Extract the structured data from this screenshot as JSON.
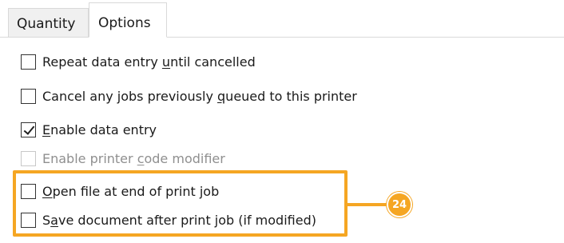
{
  "tabs": [
    {
      "label": "Quantity",
      "active": false
    },
    {
      "label": "Options",
      "active": true
    }
  ],
  "options": [
    {
      "pre": "Repeat data entry ",
      "u": "u",
      "post": "ntil cancelled",
      "checked": false,
      "enabled": true
    },
    {
      "pre": "Cancel any jobs previously ",
      "u": "q",
      "post": "ueued to this printer",
      "checked": false,
      "enabled": true
    },
    {
      "pre": "",
      "u": "E",
      "post": "nable data entry",
      "checked": true,
      "enabled": true
    },
    {
      "pre": "Enable printer ",
      "u": "c",
      "post": "ode modifier",
      "checked": false,
      "enabled": false
    },
    {
      "pre": "",
      "u": "O",
      "post": "pen file at end of print job",
      "checked": false,
      "enabled": true
    },
    {
      "pre": "S",
      "u": "a",
      "post": "ve document after print job (if modified)",
      "checked": false,
      "enabled": true
    }
  ],
  "callout": {
    "number": "24",
    "color": "#f5a623"
  }
}
